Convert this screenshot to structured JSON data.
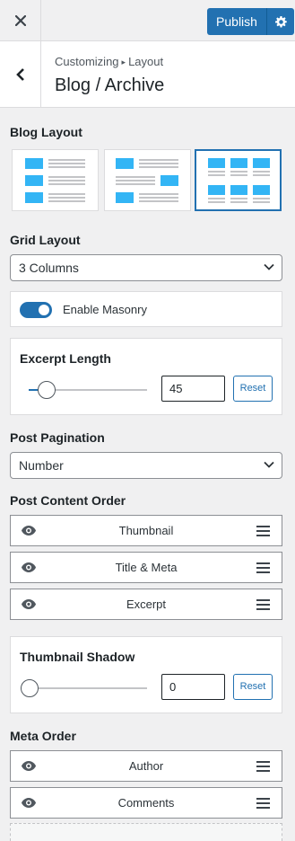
{
  "topbar": {
    "publish_label": "Publish"
  },
  "header": {
    "breadcrumb_root": "Customizing",
    "breadcrumb_section": "Layout",
    "title": "Blog / Archive"
  },
  "blog_layout": {
    "label": "Blog Layout",
    "options": [
      "list-left-thumb",
      "list-alternating",
      "grid"
    ],
    "selected": "grid"
  },
  "grid_layout": {
    "label": "Grid Layout",
    "value": "3 Columns"
  },
  "masonry": {
    "label": "Enable Masonry",
    "enabled": true
  },
  "excerpt": {
    "label": "Excerpt Length",
    "value": "45",
    "reset": "Reset",
    "level": 0.15
  },
  "pagination": {
    "label": "Post Pagination",
    "value": "Number"
  },
  "content_order": {
    "label": "Post Content Order",
    "items": [
      "Thumbnail",
      "Title & Meta",
      "Excerpt"
    ]
  },
  "shadow": {
    "label": "Thumbnail Shadow",
    "value": "0",
    "reset": "Reset",
    "level": 0
  },
  "meta_order": {
    "label": "Meta Order",
    "items": [
      "Author",
      "Comments"
    ]
  },
  "colors": {
    "accent": "#2271b1",
    "layout_icon": "#33b5f5"
  }
}
